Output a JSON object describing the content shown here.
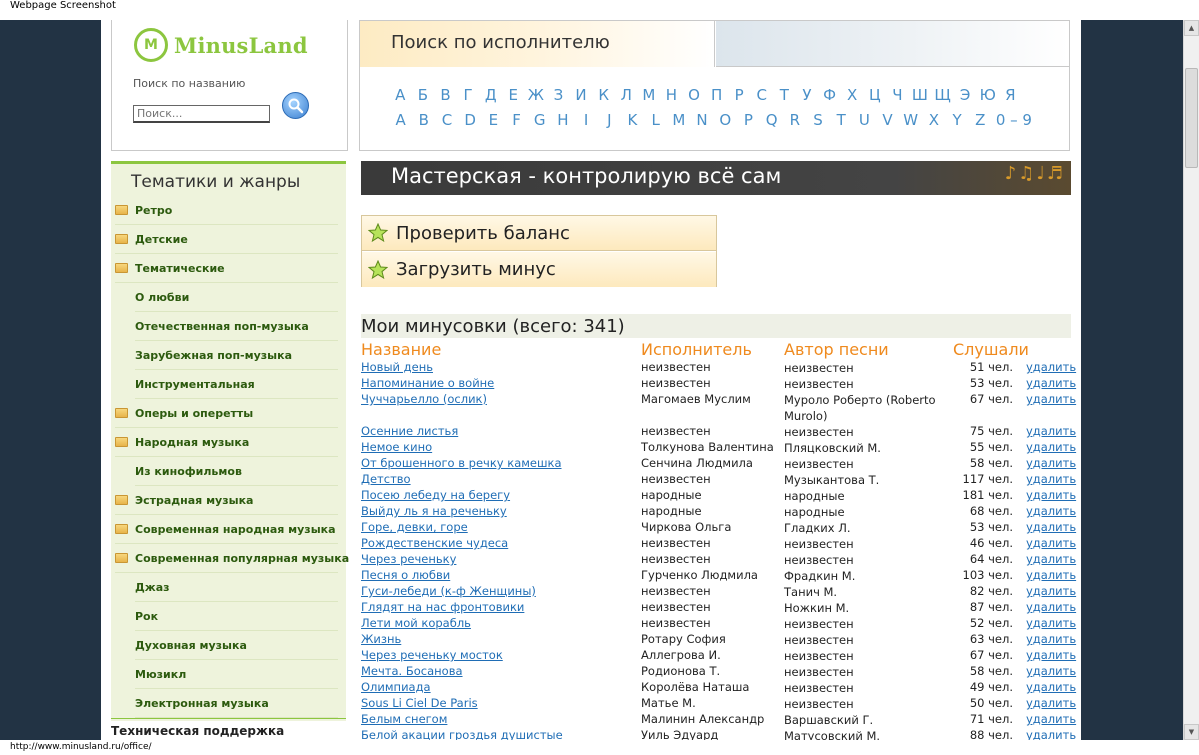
{
  "window": {
    "title": "Webpage Screenshot"
  },
  "status_url": "http://www.minusland.ru/office/",
  "logo": {
    "mark": "M",
    "name": "MinusLand"
  },
  "search": {
    "label": "Поиск по названию",
    "placeholder": "Поиск..."
  },
  "artist_search": {
    "title": "Поиск по исполнителю",
    "ru_letters": [
      "А",
      "Б",
      "В",
      "Г",
      "Д",
      "Е",
      "Ж",
      "З",
      "И",
      "К",
      "Л",
      "М",
      "Н",
      "О",
      "П",
      "Р",
      "С",
      "Т",
      "У",
      "Ф",
      "Х",
      "Ц",
      "Ч",
      "Ш",
      "Щ",
      "Э",
      "Ю",
      "Я"
    ],
    "en_letters": [
      "A",
      "B",
      "C",
      "D",
      "E",
      "F",
      "G",
      "H",
      "I",
      "J",
      "K",
      "L",
      "M",
      "N",
      "O",
      "P",
      "Q",
      "R",
      "S",
      "T",
      "U",
      "V",
      "W",
      "X",
      "Y",
      "Z",
      "0 – 9"
    ]
  },
  "sidebar": {
    "title": "Тематики и жанры",
    "items": [
      {
        "label": "Ретро",
        "folder": true
      },
      {
        "label": "Детские",
        "folder": true
      },
      {
        "label": "Тематические",
        "folder": true
      },
      {
        "label": "О любви",
        "folder": false
      },
      {
        "label": "Отечественная поп-музыка",
        "folder": false
      },
      {
        "label": "Зарубежная поп-музыка",
        "folder": false
      },
      {
        "label": "Инструментальная",
        "folder": false
      },
      {
        "label": "Оперы и оперетты",
        "folder": true
      },
      {
        "label": "Народная музыка",
        "folder": true
      },
      {
        "label": "Из кинофильмов",
        "folder": false
      },
      {
        "label": "Эстрадная музыка",
        "folder": true
      },
      {
        "label": "Современная народная музыка",
        "folder": true
      },
      {
        "label": "Современная популярная музыка",
        "folder": true
      },
      {
        "label": "Джаз",
        "folder": false
      },
      {
        "label": "Рок",
        "folder": false
      },
      {
        "label": "Духовная музыка",
        "folder": false
      },
      {
        "label": "Мюзикл",
        "folder": false
      },
      {
        "label": "Электронная музыка",
        "folder": false
      }
    ],
    "support": "Техническая поддержка"
  },
  "banner": {
    "title": "Мастерская - контролирую всё сам",
    "notes": "♪♫♩♬"
  },
  "actions": {
    "check_balance": "Проверить баланс",
    "upload_minus": "Загрузить минус"
  },
  "mylist": {
    "title": "Мои минусовки (всего: 341)",
    "columns": {
      "name": "Название",
      "artist": "Исполнитель",
      "author": "Автор песни",
      "listened": "Слушали"
    },
    "delete_label": "удалить",
    "rows": [
      {
        "name": "Новый день",
        "artist": "неизвестен",
        "author": "неизвестен",
        "listened": "51 чел."
      },
      {
        "name": "Напоминание о войне",
        "artist": "неизвестен",
        "author": "неизвестен",
        "listened": "53 чел."
      },
      {
        "name": "Чуччарьелло (ослик)",
        "artist": "Магомаев Муслим",
        "author": "Муроло Роберто (Roberto Murolo)",
        "listened": "67 чел."
      },
      {
        "name": "Осенние листья",
        "artist": "неизвестен",
        "author": "неизвестен",
        "listened": "75 чел."
      },
      {
        "name": "Немое кино",
        "artist": "Толкунова Валентина",
        "author": "Пляцковский М.",
        "listened": "55 чел."
      },
      {
        "name": "От брошенного в речку камешка",
        "artist": "Сенчина Людмила",
        "author": "неизвестен",
        "listened": "58 чел."
      },
      {
        "name": "Детство",
        "artist": "неизвестен",
        "author": "Музыкантова Т.",
        "listened": "117 чел."
      },
      {
        "name": "Посею лебеду на берегу",
        "artist": "народные",
        "author": "народные",
        "listened": "181 чел."
      },
      {
        "name": "Выйду ль я на реченьку",
        "artist": "народные",
        "author": "народные",
        "listened": "68 чел."
      },
      {
        "name": "Горе, девки, горе",
        "artist": "Чиркова Ольга",
        "author": "Гладких Л.",
        "listened": "53 чел."
      },
      {
        "name": "Рождественские чудеса",
        "artist": "неизвестен",
        "author": "неизвестен",
        "listened": "46 чел."
      },
      {
        "name": "Через реченьку",
        "artist": "неизвестен",
        "author": "неизвестен",
        "listened": "64 чел."
      },
      {
        "name": "Песня о любви",
        "artist": "Гурченко Людмила",
        "author": "Фрадкин М.",
        "listened": "103 чел."
      },
      {
        "name": "Гуси-лебеди (к-ф Женщины)",
        "artist": "неизвестен",
        "author": "Танич М.",
        "listened": "82 чел."
      },
      {
        "name": "Глядят на нас фронтовики",
        "artist": "неизвестен",
        "author": "Ножкин М.",
        "listened": "87 чел."
      },
      {
        "name": "Лети мой корабль",
        "artist": "неизвестен",
        "author": "неизвестен",
        "listened": "52 чел."
      },
      {
        "name": "Жизнь",
        "artist": "Ротару София",
        "author": "неизвестен",
        "listened": "63 чел."
      },
      {
        "name": "Через реченьку мосток",
        "artist": "Аллегрова И.",
        "author": "неизвестен",
        "listened": "67 чел."
      },
      {
        "name": "Мечта. Босанова",
        "artist": "Родионова Т.",
        "author": "неизвестен",
        "listened": "58 чел."
      },
      {
        "name": "Олимпиада",
        "artist": "Королёва Наташа",
        "author": "неизвестен",
        "listened": "49 чел."
      },
      {
        "name": "Sous Li Ciel De Paris",
        "artist": "Матье М.",
        "author": "неизвестен",
        "listened": "50 чел."
      },
      {
        "name": "Белым снегом",
        "artist": "Малинин Александр",
        "author": "Варшавский Г.",
        "listened": "71 чел."
      },
      {
        "name": "Белой акации гроздья душистые",
        "artist": "Уиль Эдуард",
        "author": "Матусовский М.",
        "listened": "88 чел."
      }
    ]
  }
}
